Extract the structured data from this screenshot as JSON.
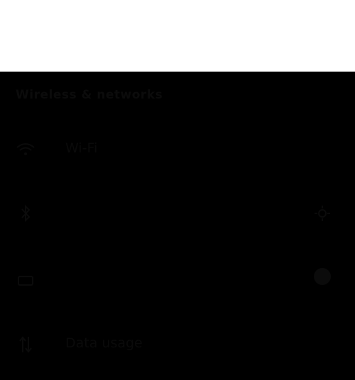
{
  "header": {
    "title": "Wireless & networks"
  },
  "rows": [
    {
      "label": "Wi-Fi",
      "icon": "wifi-icon"
    },
    {
      "label": "",
      "icon": "bluetooth-icon",
      "trailing": "settings-icon"
    },
    {
      "label": "",
      "icon": "sim-icon",
      "trailing": "toggle"
    },
    {
      "label": "Data usage",
      "icon": "data-usage-icon"
    }
  ],
  "colors": {
    "background": "#000000",
    "top_area": "#ffffff",
    "text": "#0a0a0a"
  }
}
